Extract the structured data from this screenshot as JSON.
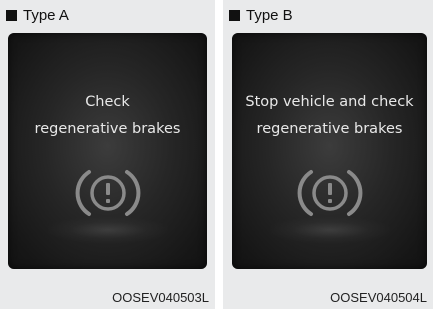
{
  "panels": [
    {
      "type_label": "Type A",
      "message_lines": [
        "Check",
        "regenerative brakes"
      ],
      "icon": "brake-warning-icon",
      "figure_code": "OOSEV040503L"
    },
    {
      "type_label": "Type B",
      "message_lines": [
        "Stop vehicle and check",
        "regenerative brakes"
      ],
      "icon": "brake-warning-icon",
      "figure_code": "OOSEV040504L"
    }
  ],
  "colors": {
    "panel_background": "#e9eaeb",
    "screen_background": "#1a1a1a",
    "message_text": "#e8e8e8",
    "icon_stroke": "#8a8a8a"
  }
}
